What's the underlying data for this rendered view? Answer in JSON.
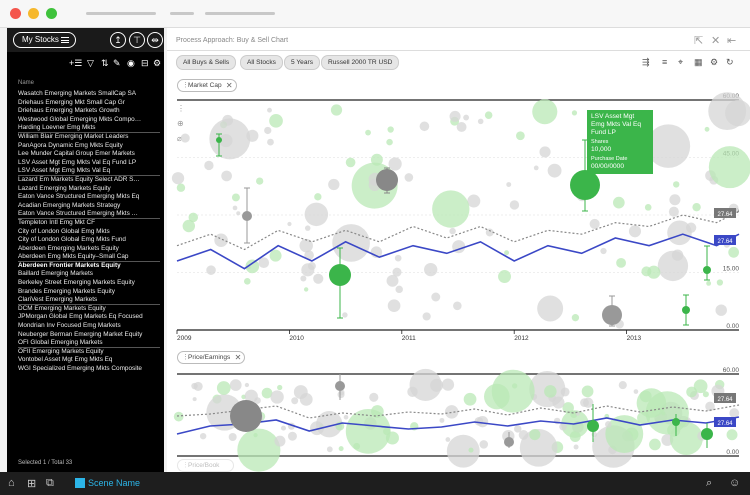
{
  "window": {
    "title_dots": [
      "#f4554c",
      "#f6b82d",
      "#3fc23c"
    ]
  },
  "sidebar": {
    "my_stocks_label": "My Stocks",
    "column_header": "Name",
    "footer": "Selected 1 / Total 33",
    "items": [
      {
        "label": "Wasatch Emerging Markets SmallCap SA",
        "sep": false,
        "selected": false
      },
      {
        "label": "Driehaus Emerging Mkt Small Cap Gr",
        "sep": false,
        "selected": false
      },
      {
        "label": "Driehaus Emerging Markets Growth",
        "sep": false,
        "selected": false
      },
      {
        "label": "Westwood Global Emerging Mkts Compo…",
        "sep": false,
        "selected": false
      },
      {
        "label": "Harding Loevner Emg Mkts",
        "sep": true,
        "selected": false
      },
      {
        "label": "William Blair Emerging Market Leaders",
        "sep": false,
        "selected": false
      },
      {
        "label": "PanAgora Dynamic Emg Mkts Equity",
        "sep": false,
        "selected": false
      },
      {
        "label": "Lee Munder Capital Group Emer Markets",
        "sep": false,
        "selected": false
      },
      {
        "label": "LSV Asset Mgt Emg Mkts Val Eq Fund LP",
        "sep": false,
        "selected": false
      },
      {
        "label": "LSV Asset Mgt Emg Mkts Val Eq",
        "sep": true,
        "selected": false
      },
      {
        "label": "Lazard Em Markets Equity Select ADR S…",
        "sep": false,
        "selected": false
      },
      {
        "label": "Lazard Emerging Markets Equity",
        "sep": false,
        "selected": false
      },
      {
        "label": "Eaton Vance Structured Emerging Mkts Eq",
        "sep": false,
        "selected": false
      },
      {
        "label": "Acadian Emerging Markets Strategy",
        "sep": false,
        "selected": false
      },
      {
        "label": "Eaton Vance Structured Emerging Mkts …",
        "sep": true,
        "selected": false
      },
      {
        "label": "Templeton Intl Emg Mkt CF",
        "sep": false,
        "selected": false
      },
      {
        "label": "City of London Global Emg Mkts",
        "sep": false,
        "selected": false
      },
      {
        "label": "City of London Global Emg Mkts Fund",
        "sep": false,
        "selected": false
      },
      {
        "label": "Aberdeen Emerging Markets Equity",
        "sep": false,
        "selected": false
      },
      {
        "label": "Aberdeen Emg Mkts Equity–Small Cap",
        "sep": true,
        "selected": false
      },
      {
        "label": "Aberdeen Frontier Markets Equity",
        "sep": false,
        "selected": true
      },
      {
        "label": "Baillard Emerging Markets",
        "sep": false,
        "selected": false
      },
      {
        "label": "Berkeley Street Emerging Markets Equity",
        "sep": false,
        "selected": false
      },
      {
        "label": "Brandes Emerging Markets Equity",
        "sep": false,
        "selected": false
      },
      {
        "label": "ClariVest Emerging Markets",
        "sep": true,
        "selected": false
      },
      {
        "label": "DCM Emerging Markets Equity",
        "sep": false,
        "selected": false
      },
      {
        "label": "JPMorgan Global Emg Markets Eq Focused",
        "sep": false,
        "selected": false
      },
      {
        "label": "Mondrian Inv Focused Emg Markets",
        "sep": false,
        "selected": false
      },
      {
        "label": "Neuberger Berman Emerging Market Equity",
        "sep": false,
        "selected": false
      },
      {
        "label": "OFI Global Emerging Markets",
        "sep": true,
        "selected": false
      },
      {
        "label": "OFII Emerging Markets Equity",
        "sep": false,
        "selected": false
      },
      {
        "label": "Vontobel Asset Mgt Emg Mkts Eq",
        "sep": false,
        "selected": false
      },
      {
        "label": "WGI Specialized Emerging Mkts Composite",
        "sep": false,
        "selected": false
      }
    ]
  },
  "main": {
    "title": "Process Approach: Buy & Sell Chart",
    "filters": [
      "All Buys & Sells",
      "All Stocks",
      "5 Years",
      "Russell 2000 TR USD"
    ],
    "chip_top": "Market Cap",
    "chip_bottom": "Price/Earnings",
    "chip_bottom_ghost": "Price/Book"
  },
  "tooltip": {
    "name": "LSV Asset Mgt Emg Mkts Val Eq Fund LP",
    "shares_label": "Shares",
    "shares_value": "10,000",
    "date_label": "Purchase Date",
    "date_value": "00/00/0000"
  },
  "bottom": {
    "scene_name": "Scene Name"
  },
  "chart_data": [
    {
      "type": "scatter",
      "title": "Market Cap",
      "x_ticks": [
        "2009",
        "2010",
        "2011",
        "2012",
        "2013"
      ],
      "y_ticks": [
        "60.00",
        "45.00",
        "30.00",
        "15.00",
        "0.00"
      ],
      "ylim": [
        0,
        60
      ],
      "series": [
        {
          "name": "",
          "color": "#3b48c6",
          "style": "solid",
          "x": [
            2009.0,
            2009.3,
            2009.6,
            2009.9,
            2010.2,
            2010.5,
            2010.8,
            2011.1,
            2011.4,
            2011.7,
            2012.0,
            2012.3,
            2012.6,
            2012.9,
            2013.2,
            2013.5,
            2013.8,
            2014.0
          ],
          "y": [
            18,
            21,
            16,
            22,
            18,
            23,
            19,
            22,
            20,
            23,
            18,
            22,
            20,
            24,
            22,
            25,
            22,
            25
          ]
        },
        {
          "name": "",
          "color": "#888888",
          "style": "dotted",
          "x": [
            2009.0,
            2009.3,
            2009.6,
            2009.9,
            2010.2,
            2010.5,
            2010.8,
            2011.1,
            2011.4,
            2011.7,
            2012.0,
            2012.3,
            2012.6,
            2012.9,
            2013.2,
            2013.5,
            2013.8,
            2014.0
          ],
          "y": [
            22,
            25,
            21,
            26,
            23,
            26,
            23,
            27,
            24,
            27,
            23,
            26,
            25,
            28,
            27,
            30,
            28,
            31
          ]
        }
      ],
      "end_labels": [
        "27.64",
        "27.64"
      ]
    },
    {
      "type": "scatter",
      "title": "Price/Earnings",
      "y_ticks": [
        "60.00",
        "0.00"
      ],
      "ylim": [
        0,
        60
      ],
      "end_labels": [
        "27.64",
        "27.64"
      ]
    }
  ]
}
